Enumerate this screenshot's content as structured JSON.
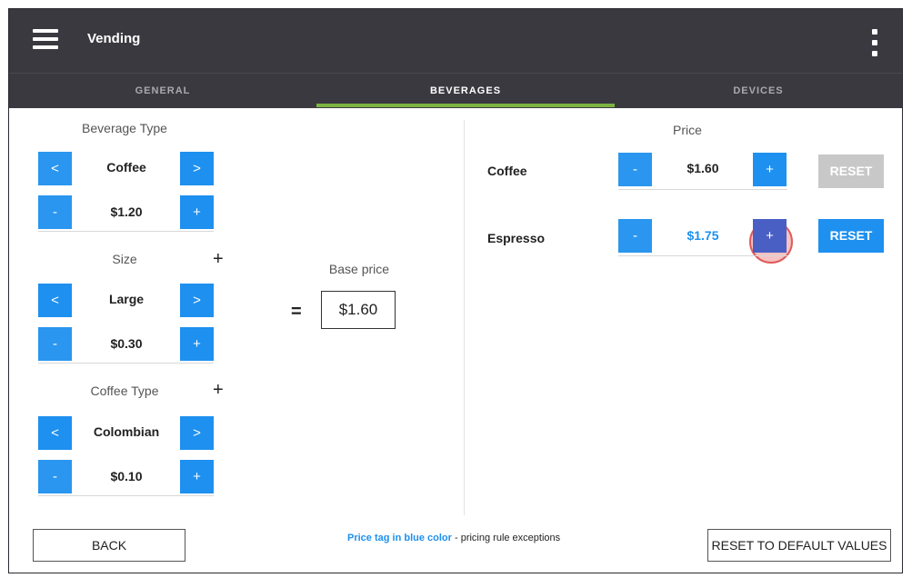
{
  "app": {
    "title": "Vending"
  },
  "tabs": [
    {
      "label": "GENERAL"
    },
    {
      "label": "BEVERAGES"
    },
    {
      "label": "DEVICES"
    }
  ],
  "left": {
    "beverage_type": {
      "label": "Beverage Type",
      "value": "Coffee",
      "price": "$1.20",
      "prev": "<",
      "next": ">",
      "minus": "-",
      "plus": "+"
    },
    "size": {
      "label": "Size",
      "value": "Large",
      "price": "$0.30",
      "add": "+",
      "prev": "<",
      "next": ">",
      "minus": "-",
      "plus": "+"
    },
    "coffee_type": {
      "label": "Coffee Type",
      "value": "Colombian",
      "price": "$0.10",
      "add": "+",
      "prev": "<",
      "next": ">",
      "minus": "-",
      "plus": "+"
    }
  },
  "middle": {
    "equals": "=",
    "base_price_label": "Base price",
    "base_price": "$1.60"
  },
  "right": {
    "price_header": "Price",
    "rows": [
      {
        "name": "Coffee",
        "price": "$1.60",
        "minus": "-",
        "plus": "+",
        "reset": "RESET",
        "reset_enabled": false
      },
      {
        "name": "Espresso",
        "price": "$1.75",
        "minus": "-",
        "plus": "+",
        "reset": "RESET",
        "reset_enabled": true
      }
    ]
  },
  "footer": {
    "back": "BACK",
    "note_blue": "Price tag in blue color",
    "note_rest": " - pricing rule exceptions",
    "reset_defaults": "RESET TO DEFAULT VALUES"
  },
  "colors": {
    "accent_blue": "#1e90ef",
    "tab_green": "#7cb342",
    "appbar": "#3a3940",
    "disabled": "#c8c8c8"
  }
}
